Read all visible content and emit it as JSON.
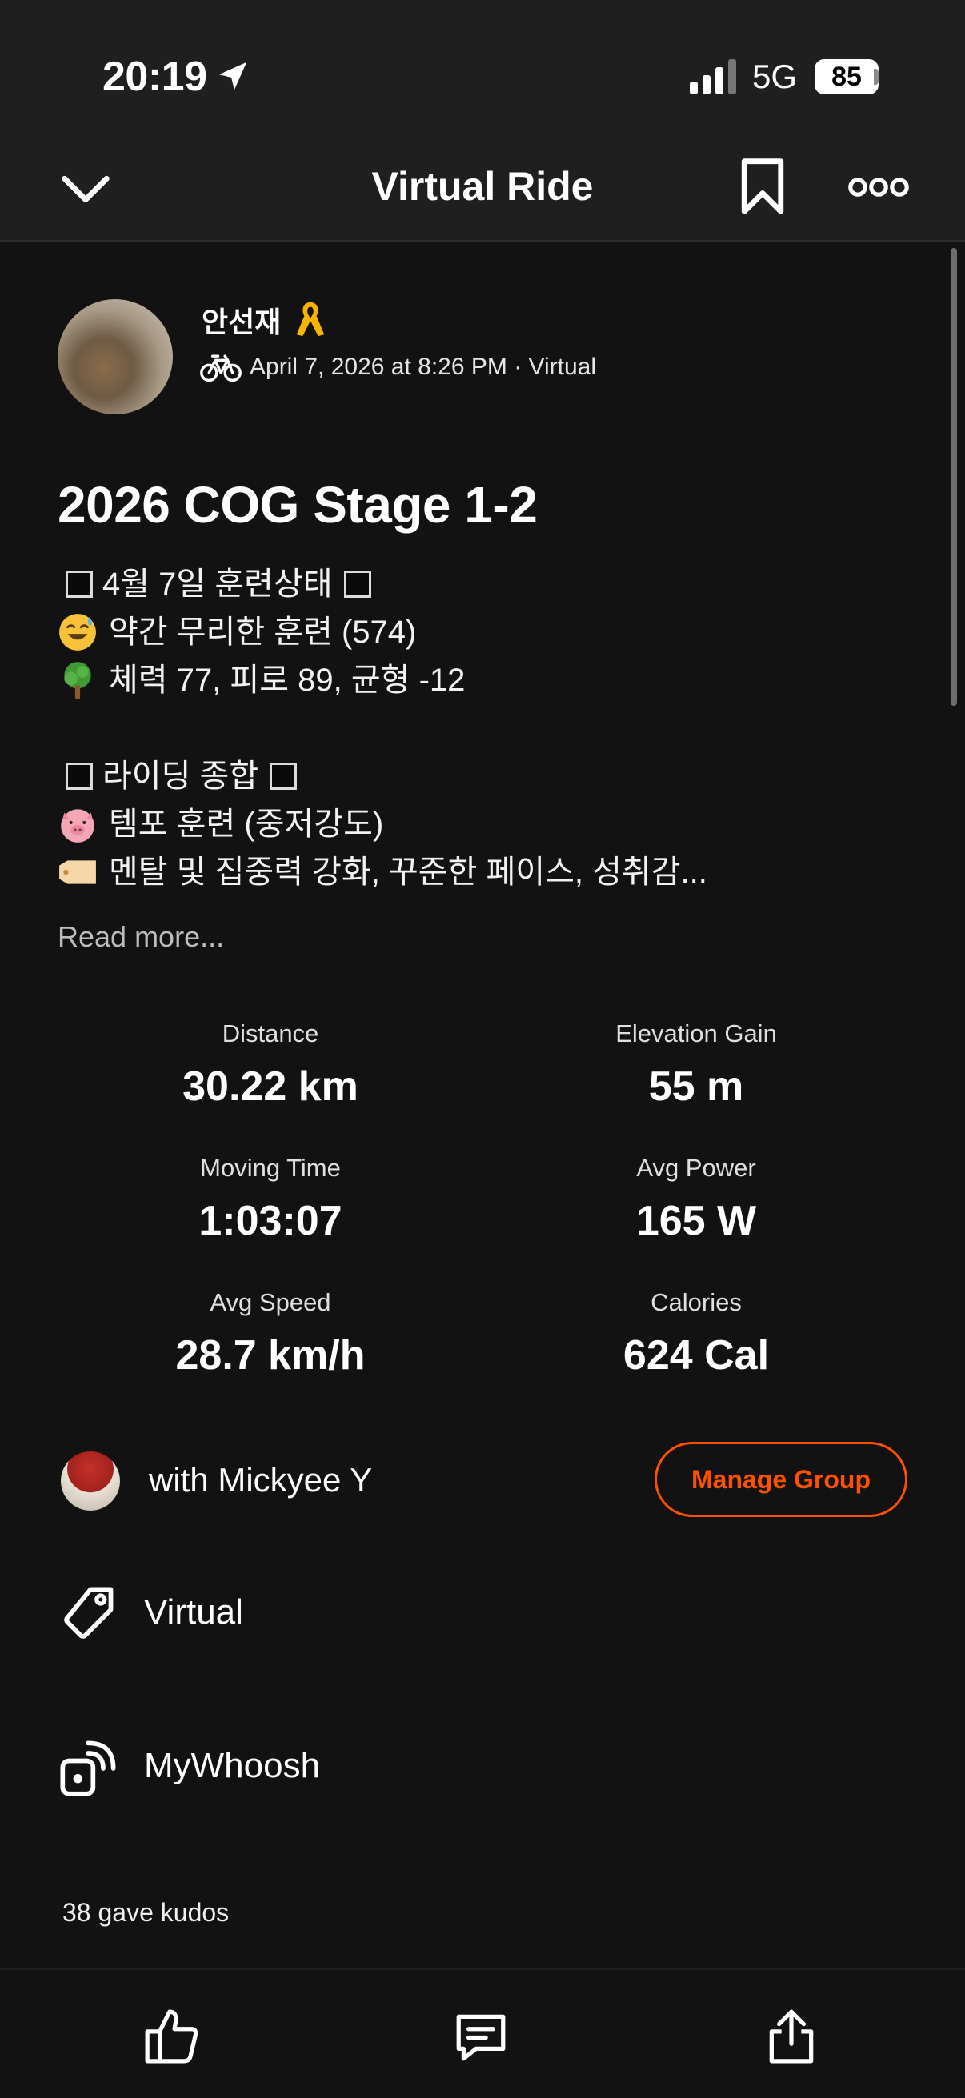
{
  "status_bar": {
    "time": "20:19",
    "network": "5G",
    "battery": "85"
  },
  "header": {
    "title": "Virtual Ride"
  },
  "activity": {
    "author_name": "안선재",
    "meta": "April 7, 2026 at 8:26 PM · Virtual",
    "title": "2026 COG Stage 1-2",
    "description": {
      "line1": "4월 7일 훈련상태",
      "line2": "약간 무리한 훈련 (574)",
      "line3": "체력 77, 피로 89, 균형 -12",
      "line5": "라이딩 종합",
      "line6": "템포 훈련 (중저강도)",
      "line7": "멘탈 및 집중력 강화, 꾸준한 페이스, 성취감..."
    },
    "read_more": "Read more..."
  },
  "stats": [
    {
      "label": "Distance",
      "value": "30.22 km"
    },
    {
      "label": "Elevation Gain",
      "value": "55 m"
    },
    {
      "label": "Moving Time",
      "value": "1:03:07"
    },
    {
      "label": "Avg Power",
      "value": "165 W"
    },
    {
      "label": "Avg Speed",
      "value": "28.7 km/h"
    },
    {
      "label": "Calories",
      "value": "624 Cal"
    }
  ],
  "group": {
    "text": "with Mickyee Y",
    "button": "Manage Group"
  },
  "tags": {
    "virtual": "Virtual",
    "device": "MyWhoosh"
  },
  "kudos": "38 gave kudos",
  "colors": {
    "accent": "#fc5200",
    "background": "#121212",
    "header": "#1f1f1f"
  },
  "icons": [
    "location-arrow-icon",
    "signal-icon",
    "chevron-down-icon",
    "bookmark-icon",
    "more-icon",
    "ribbon-icon",
    "bike-icon",
    "tag-icon",
    "device-icon",
    "thumbs-up-icon",
    "comment-icon",
    "share-icon"
  ]
}
